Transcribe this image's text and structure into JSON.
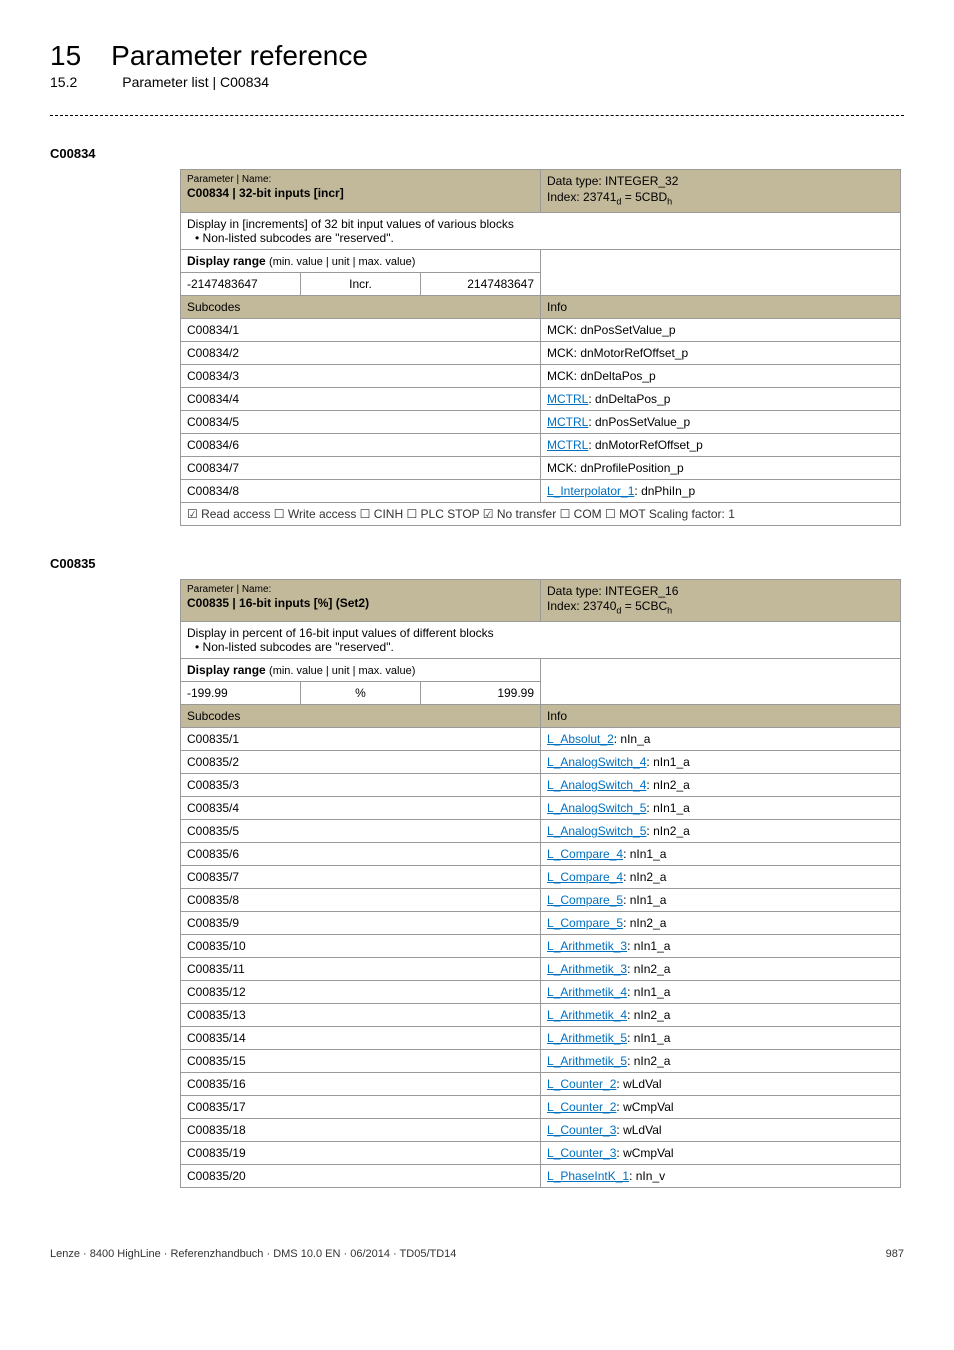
{
  "header": {
    "chapter_num": "15",
    "chapter_title": "Parameter reference",
    "sub_num": "15.2",
    "sub_title": "Parameter list | C00834"
  },
  "param1": {
    "id": "C00834",
    "name_label": "Parameter | Name:",
    "name_value": "C00834 | 32-bit inputs [incr]",
    "datatype": "Data type: INTEGER_32",
    "index": "Index: 23741",
    "index_sub_d": "d",
    "index_eq": " = 5CBD",
    "index_sub_h": "h",
    "description": "Display in [increments] of 32 bit input values of various blocks",
    "desc_bullet": "• Non-listed subcodes are \"reserved\".",
    "range_label": "Display range ",
    "range_paren": "(min. value | unit | max. value)",
    "range_min": "-2147483647",
    "range_unit": "Incr.",
    "range_max": "2147483647",
    "sub_hdr": "Subcodes",
    "info_hdr": "Info",
    "rows": [
      {
        "code": "C00834/1",
        "info": "MCK: dnPosSetValue_p",
        "link": false
      },
      {
        "code": "C00834/2",
        "info": "MCK: dnMotorRefOffset_p",
        "link": false
      },
      {
        "code": "C00834/3",
        "info": "MCK: dnDeltaPos_p",
        "link": false
      },
      {
        "code": "C00834/4",
        "info_pre": "MCTRL",
        "info_post": ": dnDeltaPos_p",
        "link": true
      },
      {
        "code": "C00834/5",
        "info_pre": "MCTRL",
        "info_post": ": dnPosSetValue_p",
        "link": true
      },
      {
        "code": "C00834/6",
        "info_pre": "MCTRL",
        "info_post": ": dnMotorRefOffset_p",
        "link": true
      },
      {
        "code": "C00834/7",
        "info": "MCK: dnProfilePosition_p",
        "link": false
      },
      {
        "code": "C00834/8",
        "info_pre": "L_Interpolator_1",
        "info_post": ": dnPhiIn_p",
        "link": true
      }
    ],
    "access": "☑ Read access  ☐ Write access  ☐ CINH  ☐ PLC STOP  ☑ No transfer  ☐ COM  ☐ MOT    Scaling factor: 1"
  },
  "param2": {
    "id": "C00835",
    "name_label": "Parameter | Name:",
    "name_value": "C00835 | 16-bit inputs [%] (Set2)",
    "datatype": "Data type: INTEGER_16",
    "index": "Index: 23740",
    "index_sub_d": "d",
    "index_eq": " = 5CBC",
    "index_sub_h": "h",
    "description": "Display in percent of 16-bit input values of different blocks",
    "desc_bullet": "• Non-listed subcodes are \"reserved\".",
    "range_label": "Display range ",
    "range_paren": "(min. value | unit | max. value)",
    "range_min": "-199.99",
    "range_unit": "%",
    "range_max": "199.99",
    "sub_hdr": "Subcodes",
    "info_hdr": "Info",
    "rows": [
      {
        "code": "C00835/1",
        "info_pre": "L_Absolut_2",
        "info_post": ": nIn_a"
      },
      {
        "code": "C00835/2",
        "info_pre": "L_AnalogSwitch_4",
        "info_post": ": nIn1_a"
      },
      {
        "code": "C00835/3",
        "info_pre": "L_AnalogSwitch_4",
        "info_post": ": nIn2_a"
      },
      {
        "code": "C00835/4",
        "info_pre": "L_AnalogSwitch_5",
        "info_post": ": nIn1_a"
      },
      {
        "code": "C00835/5",
        "info_pre": "L_AnalogSwitch_5",
        "info_post": ": nIn2_a"
      },
      {
        "code": "C00835/6",
        "info_pre": "L_Compare_4",
        "info_post": ": nIn1_a"
      },
      {
        "code": "C00835/7",
        "info_pre": "L_Compare_4",
        "info_post": ": nIn2_a"
      },
      {
        "code": "C00835/8",
        "info_pre": "L_Compare_5",
        "info_post": ": nIn1_a"
      },
      {
        "code": "C00835/9",
        "info_pre": "L_Compare_5",
        "info_post": ": nIn2_a"
      },
      {
        "code": "C00835/10",
        "info_pre": "L_Arithmetik_3",
        "info_post": ": nIn1_a"
      },
      {
        "code": "C00835/11",
        "info_pre": "L_Arithmetik_3",
        "info_post": ": nIn2_a"
      },
      {
        "code": "C00835/12",
        "info_pre": "L_Arithmetik_4",
        "info_post": ": nIn1_a"
      },
      {
        "code": "C00835/13",
        "info_pre": "L_Arithmetik_4",
        "info_post": ": nIn2_a"
      },
      {
        "code": "C00835/14",
        "info_pre": "L_Arithmetik_5",
        "info_post": ": nIn1_a"
      },
      {
        "code": "C00835/15",
        "info_pre": "L_Arithmetik_5",
        "info_post": ": nIn2_a"
      },
      {
        "code": "C00835/16",
        "info_pre": "L_Counter_2",
        "info_post": ": wLdVal"
      },
      {
        "code": "C00835/17",
        "info_pre": "L_Counter_2",
        "info_post": ": wCmpVal"
      },
      {
        "code": "C00835/18",
        "info_pre": "L_Counter_3",
        "info_post": ": wLdVal"
      },
      {
        "code": "C00835/19",
        "info_pre": "L_Counter_3",
        "info_post": ": wCmpVal"
      },
      {
        "code": "C00835/20",
        "info_pre": "L_PhaseIntK_1",
        "info_post": ": nIn_v"
      }
    ]
  },
  "footer": {
    "left": "Lenze · 8400 HighLine · Referenzhandbuch · DMS 10.0 EN · 06/2014 · TD05/TD14",
    "right": "987"
  }
}
